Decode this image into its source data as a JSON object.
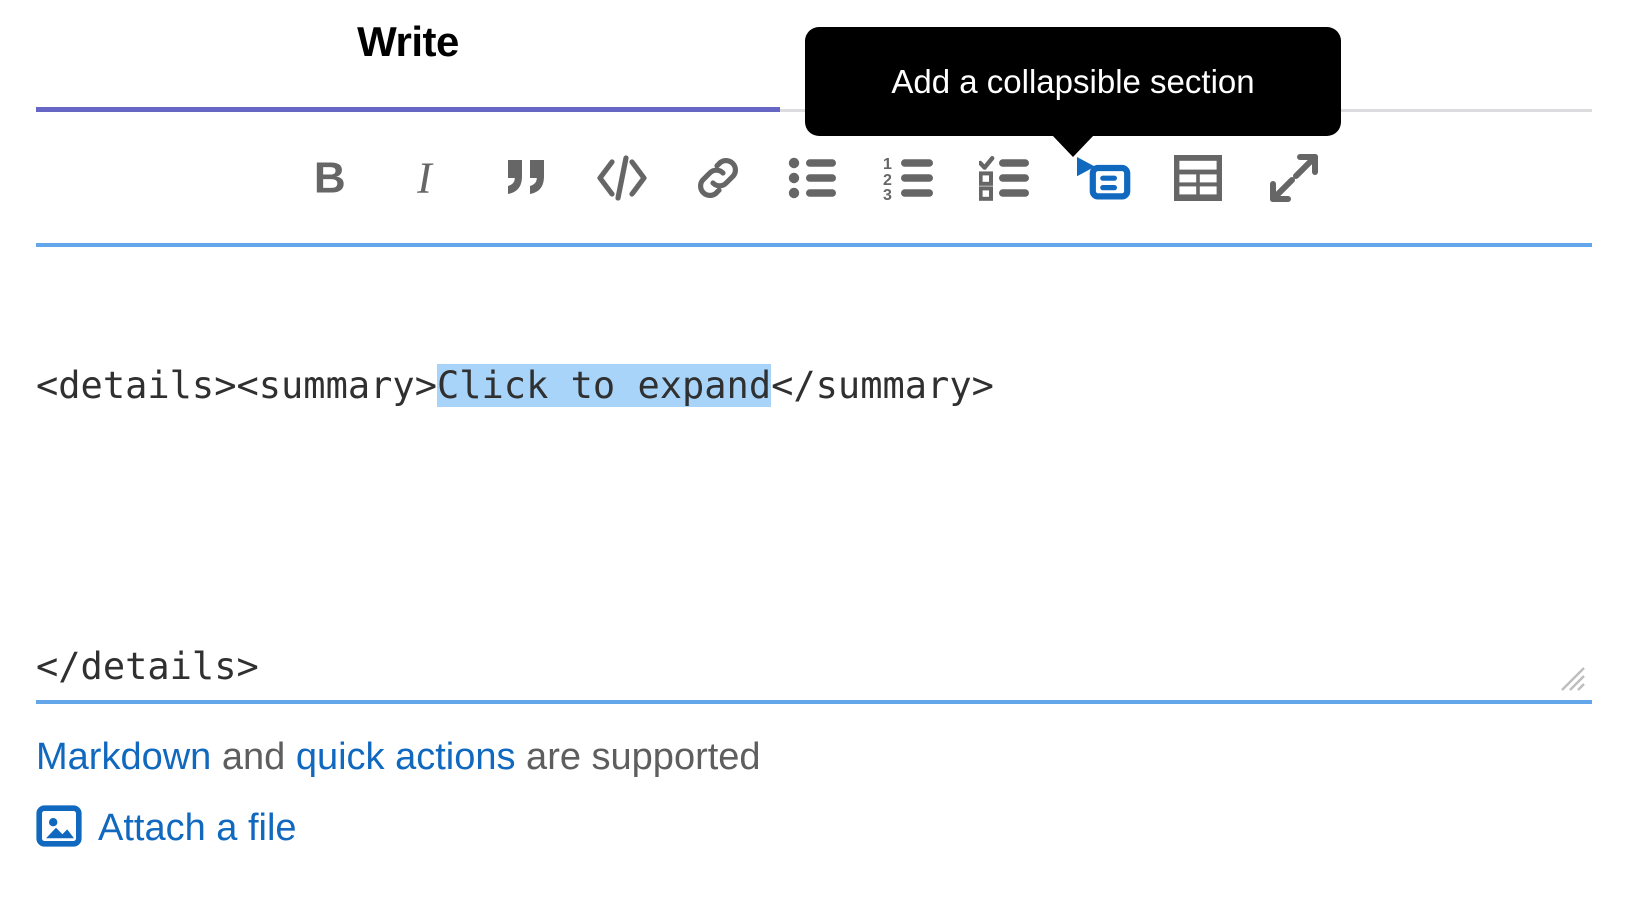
{
  "tabs": [
    {
      "label": "Write",
      "active": true
    }
  ],
  "toolbar": {
    "buttons": [
      {
        "name": "bold",
        "icon": "bold-icon",
        "title": "Add bold text",
        "active": false
      },
      {
        "name": "italic",
        "icon": "italic-icon",
        "title": "Add italic text",
        "active": false
      },
      {
        "name": "quote",
        "icon": "quote-icon",
        "title": "Insert a quote",
        "active": false
      },
      {
        "name": "code",
        "icon": "code-icon",
        "title": "Insert code",
        "active": false
      },
      {
        "name": "link",
        "icon": "link-icon",
        "title": "Add a link",
        "active": false
      },
      {
        "name": "bullet-list",
        "icon": "bullet-list-icon",
        "title": "Add a bullet list",
        "active": false
      },
      {
        "name": "numbered-list",
        "icon": "numbered-list-icon",
        "title": "Add a numbered list",
        "active": false
      },
      {
        "name": "checklist",
        "icon": "checklist-icon",
        "title": "Add a checklist",
        "active": false
      },
      {
        "name": "collapsible",
        "icon": "collapsible-section-icon",
        "title": "Add a collapsible section",
        "active": true
      },
      {
        "name": "table",
        "icon": "table-icon",
        "title": "Add a table",
        "active": false
      },
      {
        "name": "fullscreen",
        "icon": "fullscreen-icon",
        "title": "Go full screen",
        "active": false
      }
    ]
  },
  "tooltip": {
    "text": "Add a collapsible section",
    "background": "#000000",
    "color": "#ffffff"
  },
  "editor": {
    "line1_before": "<details><summary>",
    "line1_selected": "Click to expand",
    "line1_after": "</summary>",
    "line2": "",
    "line3": "</details>",
    "selection_color": "#a8d4fa",
    "border_color": "#63a6e9"
  },
  "footer": {
    "markdown_link": "Markdown",
    "and_text": " and ",
    "quick_actions_link": "quick actions",
    "supported_text": " are supported",
    "attach_label": "Attach a file",
    "attach_icon": "image-attachment-icon"
  },
  "colors": {
    "tab_underline": "#6666c4",
    "link": "#1068bf",
    "icon_gray": "#666666",
    "icon_active": "#1068bf",
    "text": "#303030"
  }
}
